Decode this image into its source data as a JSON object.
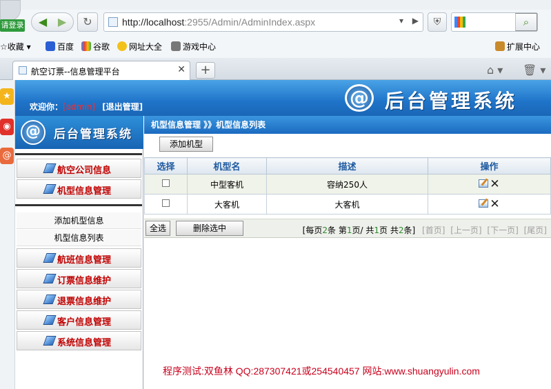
{
  "browser": {
    "login_label": "请登录",
    "url_host": "http://localhost",
    "url_rest": ":2955/Admin/AdminIndex.aspx",
    "bookmarks": [
      "收藏",
      "百度",
      "谷歌",
      "网址大全",
      "游戏中心"
    ],
    "extensions_label": "扩展中心",
    "tab_title": "航空订票--信息管理平台"
  },
  "header": {
    "welcome_prefix": "欢迎你：",
    "user": "[admin]",
    "logout": "[退出管理]",
    "system_title": "后台管理系统",
    "logo_glyph": "@"
  },
  "sidebar": {
    "logo_text": "后台管理系统",
    "menu": [
      {
        "label": "航空公司信息"
      },
      {
        "label": "机型信息管理"
      },
      {
        "label": "航班信息管理"
      },
      {
        "label": "订票信息维护"
      },
      {
        "label": "退票信息维护"
      },
      {
        "label": "客户信息管理"
      },
      {
        "label": "系统信息管理"
      }
    ],
    "submenu": [
      "添加机型信息",
      "机型信息列表"
    ]
  },
  "main": {
    "breadcrumb": "机型信息管理 》》机型信息列表",
    "add_button": "添加机型",
    "columns": [
      "选择",
      "机型名",
      "描述",
      "操作"
    ],
    "rows": [
      {
        "name": "中型客机",
        "desc": "容纳250人"
      },
      {
        "name": "大客机",
        "desc": "大客机"
      }
    ],
    "select_all": "全选",
    "delete_selected": "删除选中",
    "pager": {
      "per_page_prefix": "[每页",
      "per_page": "2",
      "per_page_suffix": "条",
      "page_prefix": "第",
      "page": "1",
      "page_mid": "页/ 共",
      "total_pages": "1",
      "page_suffix": "页",
      "total_prefix": "共",
      "total": "2",
      "total_suffix": "条]",
      "first": "[首页]",
      "prev": "[上一页]",
      "next": "[下一页]",
      "last": "[尾页]"
    }
  },
  "credit": "程序测试:双鱼林 QQ:287307421或254540457 网站:www.shuangyulin.com"
}
